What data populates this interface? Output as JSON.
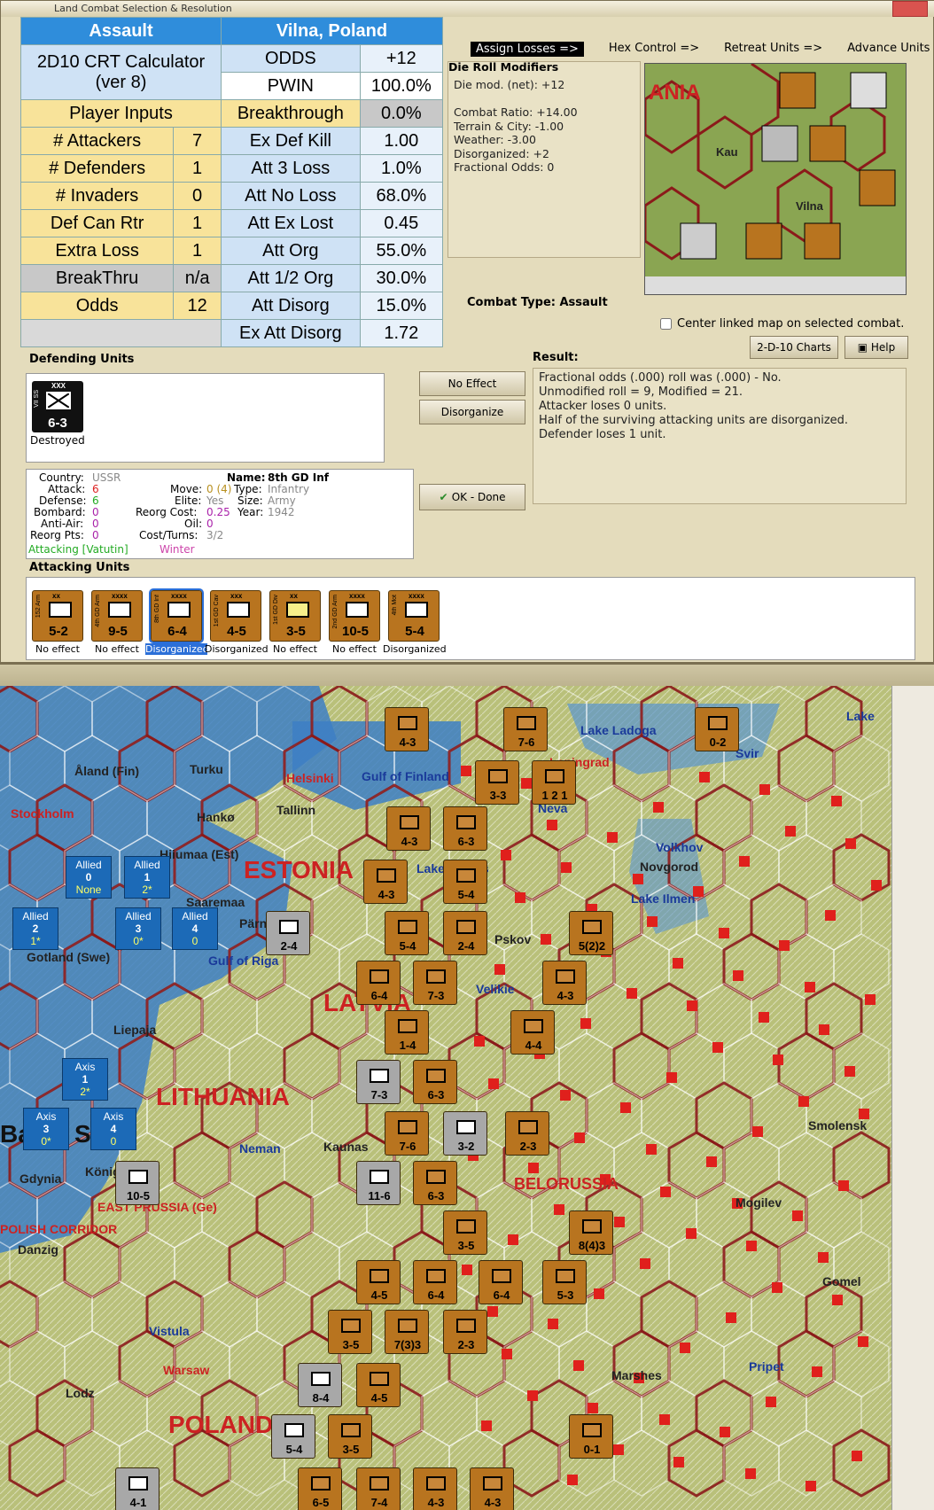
{
  "window": {
    "title": "Land Combat Selection & Resolution"
  },
  "crt": {
    "header_left": "Assault",
    "header_right": "Vilna, Poland",
    "calc_line1": "2D10 CRT Calculator",
    "calc_line2": "(ver 8)",
    "player_inputs": "Player Inputs",
    "inputs": [
      {
        "label": "# Attackers",
        "value": "7"
      },
      {
        "label": "# Defenders",
        "value": "1"
      },
      {
        "label": "# Invaders",
        "value": "0"
      },
      {
        "label": "Def Can Rtr",
        "value": "1"
      },
      {
        "label": "Extra Loss",
        "value": "1"
      },
      {
        "label": "BreakThru",
        "value": "n/a"
      },
      {
        "label": "Odds",
        "value": "12"
      }
    ],
    "results": [
      {
        "label": "ODDS",
        "value": "+12"
      },
      {
        "label": "PWIN",
        "value": "100.0%"
      },
      {
        "label": "Breakthrough",
        "value": "0.0%"
      },
      {
        "label": "Ex Def Kill",
        "value": "1.00"
      },
      {
        "label": "Att 3 Loss",
        "value": "1.0%"
      },
      {
        "label": "Att No Loss",
        "value": "68.0%"
      },
      {
        "label": "Att Ex Lost",
        "value": "0.45"
      },
      {
        "label": "Att Org",
        "value": "55.0%"
      },
      {
        "label": "Att 1/2 Org",
        "value": "30.0%"
      },
      {
        "label": "Att Disorg",
        "value": "15.0%"
      },
      {
        "label": "Ex Att Disorg",
        "value": "1.72"
      }
    ]
  },
  "steps": {
    "assign": "Assign Losses =>",
    "hex": "Hex Control =>",
    "retreat": "Retreat Units =>",
    "advance": "Advance Units"
  },
  "drm": {
    "title": "Die Roll Modifiers",
    "body": "Die mod. (net): +12\n\nCombat Ratio: +14.00\nTerrain & City: -1.00\nWeather: -3.00\nDisorganized: +2\nFractional Odds: 0"
  },
  "combat_type": "Combat Type:  Assault",
  "center_linked": "Center linked map on selected combat.",
  "buttons": {
    "charts": "2-D-10 Charts",
    "help": "Help",
    "no_effect": "No Effect",
    "disorganize": "Disorganize",
    "ok_done": "OK - Done"
  },
  "defending": {
    "label": "Defending Units",
    "unit_side": "VII SS",
    "unit_size": "XXX",
    "unit_str": "6-3",
    "status": "Destroyed"
  },
  "result": {
    "label": "Result:",
    "lines": [
      "Fractional odds (.000) roll was (.000)  - No.",
      "Unmodified roll = 9, Modified = 21.",
      "Attacker loses 0 units.",
      "Half of the surviving attacking units are disorganized.",
      "Defender loses 1 unit."
    ]
  },
  "info": {
    "country_l": "Country:",
    "country": "USSR",
    "attack_l": "Attack:",
    "attack": "6",
    "defense_l": "Defense:",
    "defense": "6",
    "bombard_l": "Bombard:",
    "bombard": "0",
    "antiair_l": "Anti-Air:",
    "antiair": "0",
    "reorg_l": "Reorg Pts:",
    "reorg": "0",
    "name_l": "Name:",
    "name": "8th GD Inf",
    "move_l": "Move:",
    "move": "0 (4)",
    "type_l": "Type:",
    "type": "Infantry",
    "elite_l": "Elite:",
    "elite": "Yes",
    "size_l": "Size:",
    "size": "Army",
    "rcost_l": "Reorg Cost:",
    "rcost": "0.25",
    "year_l": "Year:",
    "year": "1942",
    "oil_l": "Oil:",
    "oil": "0",
    "cost_l": "Cost/Turns:",
    "cost": "3/2",
    "attacking": "Attacking [Vatutin]",
    "season": "Winter"
  },
  "attacking": {
    "label": "Attacking Units",
    "units": [
      {
        "side": "152 Arm",
        "size": "xx",
        "str": "5-2",
        "status": "No effect"
      },
      {
        "side": "4th GD Arm",
        "size": "xxxx",
        "str": "9-5",
        "status": "No effect"
      },
      {
        "side": "8th GD Inf",
        "size": "xxxx",
        "str": "6-4",
        "status": "Disorganized"
      },
      {
        "side": "1st GD Cav",
        "size": "xxx",
        "str": "4-5",
        "status": "Disorganized"
      },
      {
        "side": "1st GD Div",
        "size": "xx",
        "str": "3-5",
        "status": "No effect"
      },
      {
        "side": "2nd GD Arm",
        "size": "xxxx",
        "str": "10-5",
        "status": "No effect"
      },
      {
        "side": "4th Mot",
        "size": "xxxx",
        "str": "5-4",
        "status": "Disorganized"
      }
    ]
  },
  "map": {
    "labels": [
      "Lake Ladoga",
      "Lake",
      "Åland (Fin)",
      "Turku",
      "Helsinki",
      "Gulf of Finland",
      "Leningrad",
      "Svir",
      "Stockholm",
      "Hankø",
      "Tallinn",
      "Neva",
      "Volkhov",
      "Novgorod",
      "Hiiumaa (Est)",
      "ESTONIA",
      "Lake Peipus",
      "Lake Ilmen",
      "Saaremaa",
      "Pärnu",
      "Gotland (Swe)",
      "Gulf of Riga",
      "Pskov",
      "Velikie",
      "LATVIA",
      "Liepaja",
      "LITHUANIA",
      "Baltic Sea",
      "Neman",
      "Kaunas",
      "Smolensk",
      "Gdynia",
      "Königsberg",
      "EAST PRUSSIA (Ge)",
      "BELORUSSIA",
      "Mogilev",
      "Danzig",
      "POLISH CORRIDOR",
      "Gomel",
      "Vistula",
      "Warsaw",
      "Lodz",
      "POLAND",
      "Pripet",
      "Marshes"
    ],
    "allied_boxes": [
      {
        "t": "Allied",
        "n": "0",
        "s": "None"
      },
      {
        "t": "Allied",
        "n": "1",
        "s": "2*"
      },
      {
        "t": "Allied",
        "n": "2",
        "s": "1*"
      },
      {
        "t": "Allied",
        "n": "3",
        "s": "0*"
      },
      {
        "t": "Allied",
        "n": "4",
        "s": "0"
      }
    ],
    "axis_boxes": [
      {
        "t": "Axis",
        "n": "1",
        "s": "2*"
      },
      {
        "t": "Axis",
        "n": "3",
        "s": "0*"
      },
      {
        "t": "Axis",
        "n": "4",
        "s": "0"
      }
    ],
    "counters": [
      "4-3",
      "7-6",
      "0-2",
      "3-3",
      "1 2 1",
      "4-3",
      "6-3",
      "4-3",
      "5-4",
      "2-4",
      "5-4",
      "2-4",
      "5(2)2",
      "6-4",
      "7-3",
      "4-3",
      "1-4",
      "4-4",
      "7-3",
      "6-3",
      "7-6",
      "3-2",
      "2-3",
      "11-6",
      "6-3",
      "10-5",
      "3-5",
      "8(4)3",
      "4-5",
      "6-4",
      "6-4",
      "5-3",
      "3-5",
      "7(3)3",
      "2-3",
      "8-4",
      "4-5",
      "5-4",
      "3-5",
      "0-1",
      "4-1",
      "6-5",
      "7-4",
      "4-3",
      "4-3"
    ]
  },
  "colors": {
    "blue_header": "#2f8ddb",
    "yellow": "#f8e39a",
    "soviet": "#b8741f",
    "german": "#9a9a9a"
  }
}
